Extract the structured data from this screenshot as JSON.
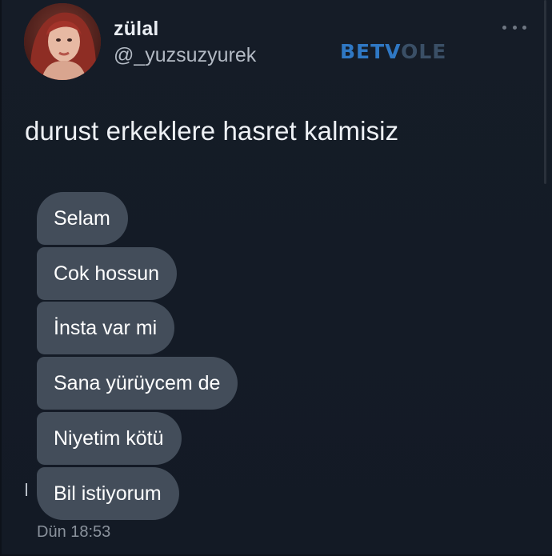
{
  "profile": {
    "display_name": "zülal",
    "handle": "@_yuzsuzyurek",
    "avatar_icon": "profile-photo"
  },
  "watermark": {
    "part1": "BETV",
    "part2": "OLE"
  },
  "header": {
    "more_icon": "more-dots-icon"
  },
  "tweet": {
    "text": "durust erkeklere hasret kalmisiz"
  },
  "chat": {
    "messages": [
      "Selam",
      "Cok hossun",
      "İnsta var mi",
      "Sana yürüycem de",
      "Niyetim kötü",
      "Bil istiyorum"
    ],
    "timestamp": "Dün 18:53"
  },
  "colors": {
    "background": "#141b26",
    "bubble": "#434d5a",
    "watermark_accent": "#2f78c4"
  }
}
